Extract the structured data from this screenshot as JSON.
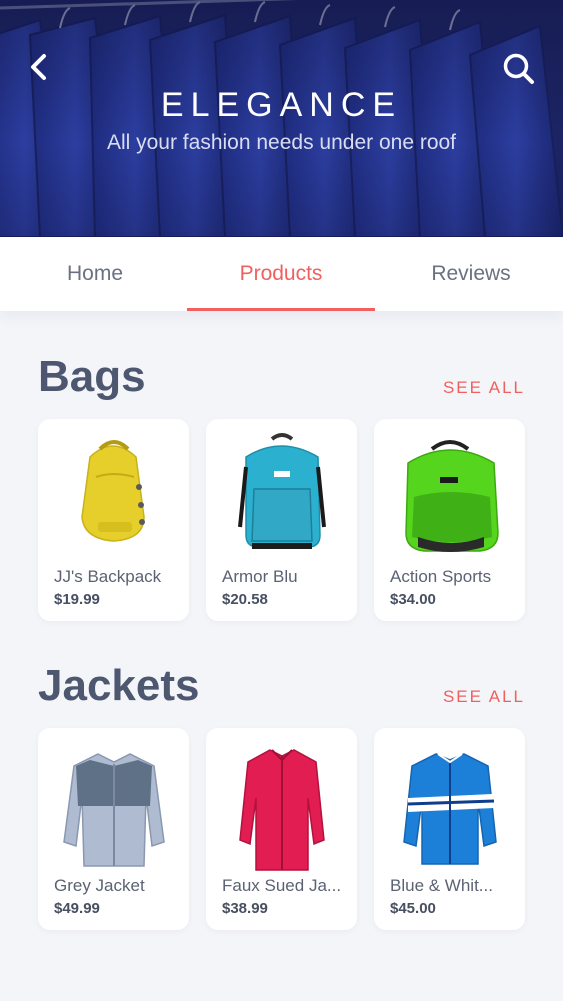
{
  "header": {
    "brand": "ELEGANCE",
    "tagline": "All your fashion needs under one roof",
    "back_icon": "chevron-left-icon",
    "search_icon": "search-icon"
  },
  "tabs": [
    {
      "label": "Home",
      "active": false
    },
    {
      "label": "Products",
      "active": true
    },
    {
      "label": "Reviews",
      "active": false
    }
  ],
  "colors": {
    "accent": "#f0605e",
    "hero": "#22307f",
    "text": "#4d5870"
  },
  "sections": [
    {
      "title": "Bags",
      "see_all": "SEE ALL",
      "items": [
        {
          "name": "JJ's Backpack",
          "price": "$19.99",
          "icon": "yellow-backpack-image"
        },
        {
          "name": "Armor Blu",
          "price": "$20.58",
          "icon": "blue-backpack-image"
        },
        {
          "name": "Action Sports",
          "price": "$34.00",
          "icon": "green-backpack-image"
        }
      ]
    },
    {
      "title": "Jackets",
      "see_all": "SEE ALL",
      "items": [
        {
          "name": "Grey Jacket",
          "price": "$49.99",
          "icon": "grey-jacket-image"
        },
        {
          "name": "Faux Sued Ja...",
          "price": "$38.99",
          "icon": "pink-jacket-image"
        },
        {
          "name": "Blue & Whit...",
          "price": "$45.00",
          "icon": "blue-white-jacket-image"
        }
      ]
    }
  ]
}
